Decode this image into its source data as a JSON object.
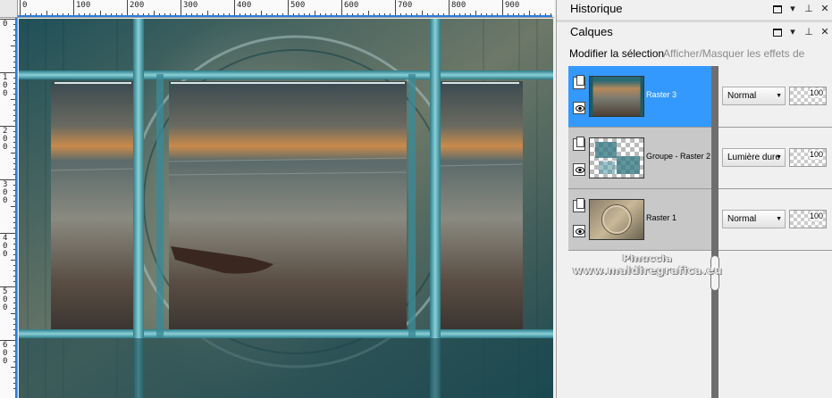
{
  "rulers": {
    "horizontal_labels": [
      "0",
      "100",
      "200",
      "300",
      "400",
      "500",
      "600",
      "700",
      "800",
      "900"
    ],
    "vertical_labels": [
      "0",
      "100",
      "200",
      "300",
      "400",
      "500",
      "600"
    ]
  },
  "history_panel": {
    "title": "Historique"
  },
  "layers_panel": {
    "title": "Calques",
    "toolbar": {
      "modify_selection": "Modifier la sélection",
      "toggle_effects": "Afficher/Masquer les effets de calque"
    },
    "layers": [
      {
        "name": "Raster 3",
        "blend_mode": "Normal",
        "opacity": "100",
        "selected": true
      },
      {
        "name": "Groupe - Raster 2",
        "blend_mode": "Lumière dure",
        "opacity": "100",
        "selected": false
      },
      {
        "name": "Raster 1",
        "blend_mode": "Normal",
        "opacity": "100",
        "selected": false
      }
    ]
  },
  "watermark": {
    "line1": "Pinuccia",
    "line2": "www.maldiregrafica.eu"
  },
  "colors": {
    "selection": "#3399ff",
    "teal_frame": "#4aa3b0"
  },
  "icons": [
    "maximize-icon",
    "dropdown-arrow-icon",
    "pin-icon",
    "close-icon",
    "group-layer-icon",
    "eye-icon"
  ]
}
